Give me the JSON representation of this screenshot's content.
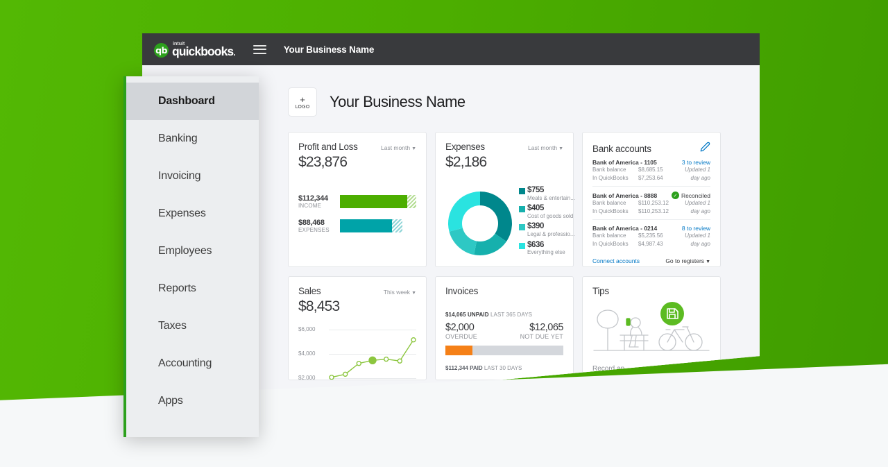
{
  "theme": {
    "brand_green": "#4cae00",
    "qb_green": "#2ca01c",
    "topbar_dark": "#393a3d",
    "link_blue": "#0077c5",
    "teal": "#00a3a8",
    "orange": "#f58017",
    "muted_text": "#8d9096"
  },
  "topbar": {
    "logo_mark": "qb",
    "logo_intuit": "intuit",
    "logo_name": "quickbooks",
    "logo_dot": ".",
    "menu_icon": "hamburger-menu-icon",
    "title": "Your Business Name"
  },
  "sidebar": {
    "items": [
      {
        "label": "Dashboard",
        "active": true
      },
      {
        "label": "Banking",
        "active": false
      },
      {
        "label": "Invoicing",
        "active": false
      },
      {
        "label": "Expenses",
        "active": false
      },
      {
        "label": "Employees",
        "active": false
      },
      {
        "label": "Reports",
        "active": false
      },
      {
        "label": "Taxes",
        "active": false
      },
      {
        "label": "Accounting",
        "active": false
      },
      {
        "label": "Apps",
        "active": false
      }
    ]
  },
  "business_header": {
    "logo_plus": "+",
    "logo_placeholder": "LOGO",
    "name": "Your Business Name"
  },
  "cards": {
    "profit_and_loss": {
      "title": "Profit and Loss",
      "range": "Last month",
      "amount": "$23,876",
      "rows": [
        {
          "value": "$112,344",
          "category": "INCOME",
          "solid_pct": 88,
          "hatch_pct": 12
        },
        {
          "value": "$88,468",
          "category": "EXPENSES",
          "solid_pct": 68,
          "hatch_pct": 14
        }
      ]
    },
    "expenses": {
      "title": "Expenses",
      "range": "Last month",
      "amount": "$2,186",
      "legend": [
        {
          "value": "$755",
          "label": "Meals & entertain...",
          "color": "#00878c"
        },
        {
          "value": "$405",
          "label": "Cost of goods sold",
          "color": "#16b0ad"
        },
        {
          "value": "$390",
          "label": "Legal & professio...",
          "color": "#2ec8c4"
        },
        {
          "value": "$636",
          "label": "Everything else",
          "color": "#2ae3e0"
        }
      ]
    },
    "bank_accounts": {
      "title": "Bank accounts",
      "edit_icon": "pencil-icon",
      "accounts": [
        {
          "name": "Bank of America - 1105",
          "status": "3 to review",
          "status_type": "review",
          "bank_balance_label": "Bank balance",
          "bank_balance": "$8,685.15",
          "in_qb_label": "In QuickBooks",
          "in_qb": "$7,253.64",
          "updated_line1": "Updated 1",
          "updated_line2": "day ago"
        },
        {
          "name": "Bank of America - 8888",
          "status": "Reconciled",
          "status_type": "reconciled",
          "bank_balance_label": "Bank balance",
          "bank_balance": "$110,253.12",
          "in_qb_label": "In QuickBooks",
          "in_qb": "$110,253.12",
          "updated_line1": "Updated 1",
          "updated_line2": "day ago"
        },
        {
          "name": "Bank of America - 0214",
          "status": "8 to review",
          "status_type": "review",
          "bank_balance_label": "Bank balance",
          "bank_balance": "$5,235.56",
          "in_qb_label": "In QuickBooks",
          "in_qb": "$4,987.43",
          "updated_line1": "Updated 1",
          "updated_line2": "day ago"
        }
      ],
      "connect_accounts": "Connect accounts",
      "go_to_registers": "Go to registers"
    },
    "sales": {
      "title": "Sales",
      "range": "This week",
      "amount": "$8,453"
    },
    "invoices": {
      "title": "Invoices",
      "unpaid_amount": "$14,065 UNPAID",
      "unpaid_period": "LAST 365 DAYS",
      "overdue_amount": "$2,000",
      "overdue_label": "OVERDUE",
      "notdue_amount": "$12,065",
      "notdue_label": "NOT DUE YET",
      "overdue_pct": 23,
      "paid_amount": "$112,344 PAID",
      "paid_period": "LAST 30 DAYS"
    },
    "tips": {
      "title": "Tips",
      "illustration": "person-on-bench-with-tree-and-bicycle-illustration",
      "badge_icon": "save-document-icon",
      "subtitle": "Record an"
    }
  },
  "chart_data": [
    {
      "type": "pie",
      "title": "Expenses",
      "subtitle": "Last month",
      "total": 2186,
      "categories": [
        "Meals & entertain...",
        "Cost of goods sold",
        "Legal & professio...",
        "Everything else"
      ],
      "values": [
        755,
        405,
        390,
        636
      ],
      "colors": [
        "#00878c",
        "#16b0ad",
        "#2ec8c4",
        "#2ae3e0"
      ],
      "donut": true,
      "legend": "right"
    },
    {
      "type": "bar",
      "title": "Profit and Loss",
      "subtitle": "Last month",
      "orientation": "horizontal",
      "categories": [
        "INCOME",
        "EXPENSES"
      ],
      "values": [
        112344,
        88468
      ],
      "colors": [
        "#4cae00",
        "#00a3a8"
      ],
      "net": 23876,
      "grid": false
    },
    {
      "type": "line",
      "title": "Sales",
      "subtitle": "This week",
      "total": 8453,
      "x": [
        1,
        2,
        3,
        4,
        5,
        6,
        7
      ],
      "values": [
        2050,
        2300,
        3200,
        3450,
        3550,
        3400,
        5150
      ],
      "ylabel": "",
      "xlabel": "",
      "ytick_labels": [
        "$6,000",
        "$4,000",
        "$2,000"
      ],
      "ytick_values": [
        6000,
        4000,
        2000
      ],
      "ylim": [
        1800,
        6400
      ],
      "color": "#8cc63f",
      "grid": true,
      "highlight_index": 3
    },
    {
      "type": "bar",
      "title": "Invoices",
      "orientation": "stacked-horizontal",
      "categories": [
        "OVERDUE",
        "NOT DUE YET"
      ],
      "values": [
        2000,
        12065
      ],
      "colors": [
        "#f58017",
        "#d4d7dc"
      ],
      "total_unpaid": 14065,
      "paid": 112344
    }
  ]
}
